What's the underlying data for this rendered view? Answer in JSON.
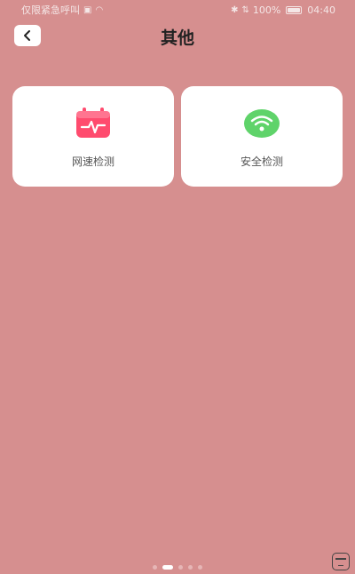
{
  "status_bar": {
    "left_text": "仅限紧急呼叫",
    "battery": "100%",
    "time": "04:40"
  },
  "header": {
    "title": "其他"
  },
  "cards": [
    {
      "label": "网速检测",
      "icon": "speed-test-icon"
    },
    {
      "label": "安全检测",
      "icon": "wifi-security-icon"
    }
  ],
  "colors": {
    "background": "#d68f8f",
    "card": "#ffffff",
    "speed_icon": "#ff4b6e",
    "wifi_icon": "#5fd36a"
  }
}
